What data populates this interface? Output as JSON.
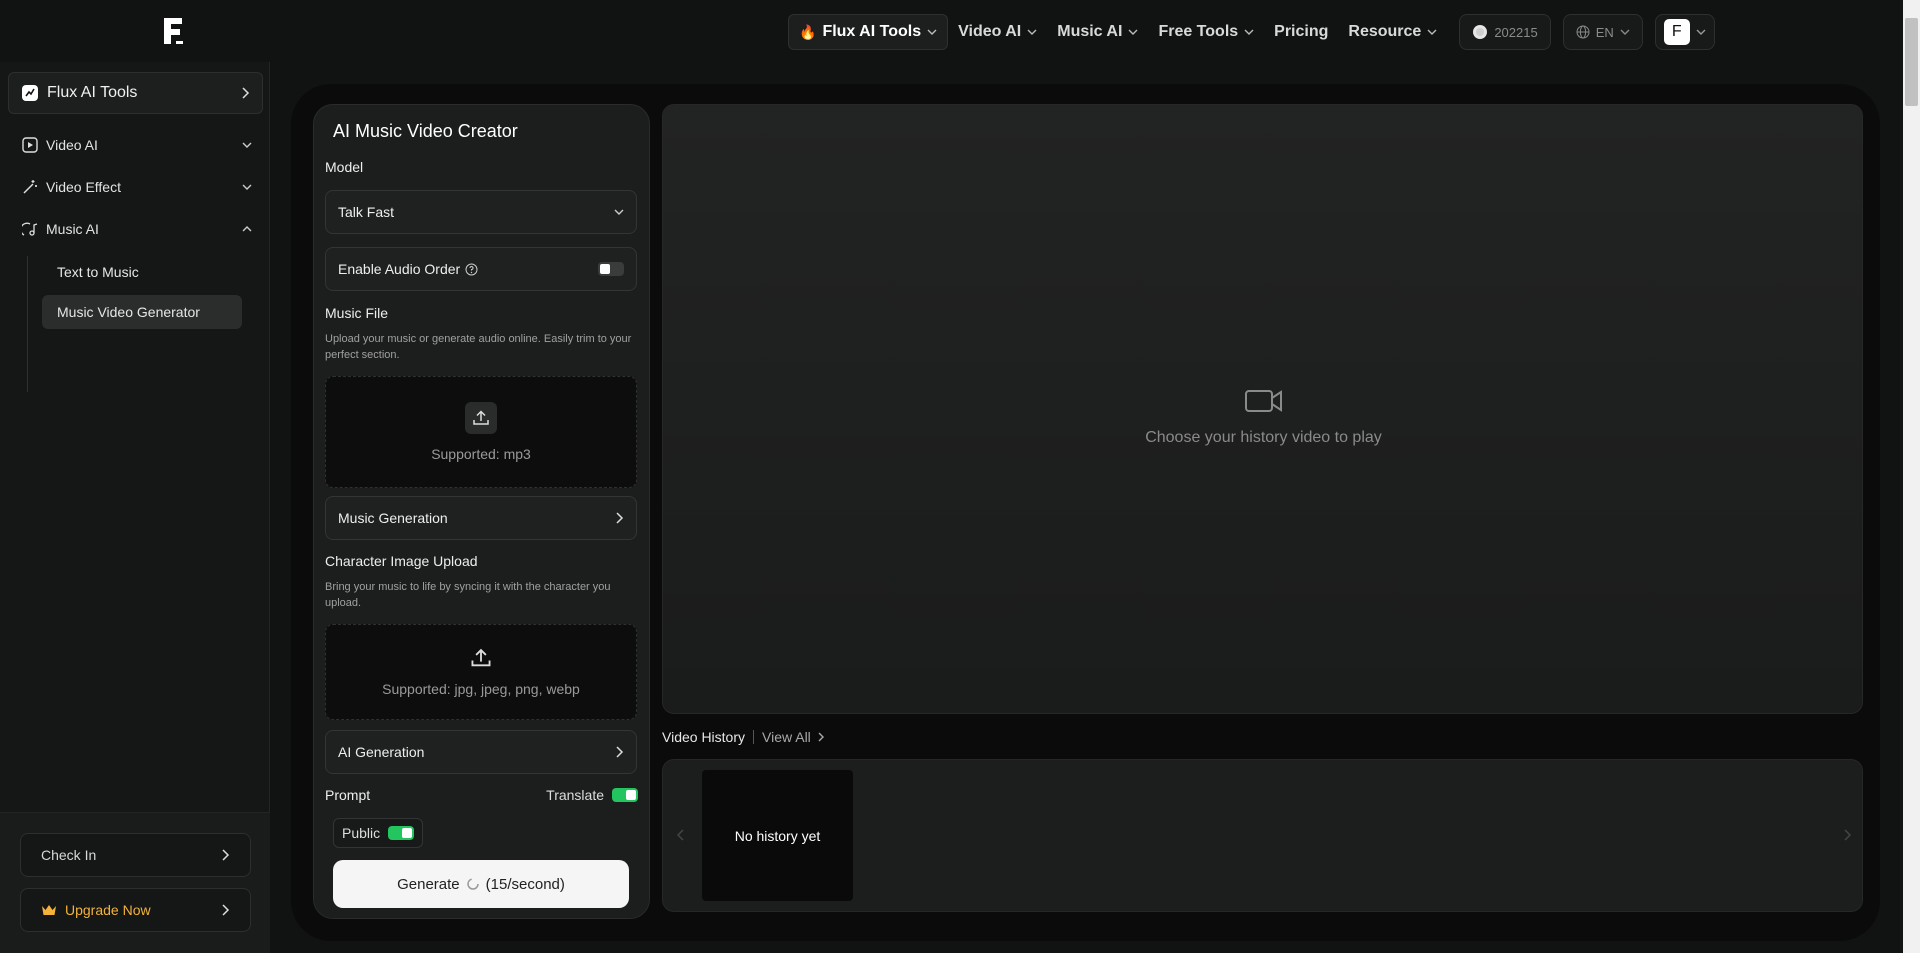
{
  "header": {
    "nav": [
      {
        "label": "Flux AI Tools",
        "emoji": "🔥"
      },
      {
        "label": "Video AI"
      },
      {
        "label": "Music AI"
      },
      {
        "label": "Free Tools"
      },
      {
        "label": "Pricing"
      },
      {
        "label": "Resource"
      }
    ],
    "credits": "202215",
    "language": "EN",
    "avatar_letter": "F"
  },
  "sidebar": {
    "top_label": "Flux AI Tools",
    "items": [
      {
        "label": "Video AI",
        "icon": "play-square-icon"
      },
      {
        "label": "Video Effect",
        "icon": "magic-wand-icon"
      },
      {
        "label": "Music AI",
        "icon": "music-note-icon"
      }
    ],
    "sub_items": [
      "Text to Music",
      "Music Video Generator"
    ],
    "check_in": "Check In",
    "upgrade": "Upgrade Now"
  },
  "panel": {
    "title": "AI Music Video Creator",
    "model_label": "Model",
    "model_value": "Talk Fast",
    "audio_order_label": "Enable Audio Order",
    "music_file_label": "Music File",
    "music_file_desc": "Upload your music or generate audio online. Easily trim to your perfect section.",
    "music_supported": "Supported: mp3",
    "music_generation": "Music Generation",
    "char_label": "Character Image Upload",
    "char_desc": "Bring your music to life by syncing it with the character you upload.",
    "char_supported": "Supported: jpg, jpeg, png, webp",
    "ai_generation": "AI Generation",
    "prompt_label": "Prompt",
    "translate_label": "Translate",
    "public_label": "Public",
    "generate_label": "Generate",
    "generate_rate": "(15/second)"
  },
  "video": {
    "empty_text": "Choose your history video to play"
  },
  "history": {
    "title": "Video History",
    "view_all": "View All",
    "empty_text": "No history yet"
  },
  "colors": {
    "accent_green": "#22c55e",
    "upgrade_gold": "#f3b33b"
  }
}
